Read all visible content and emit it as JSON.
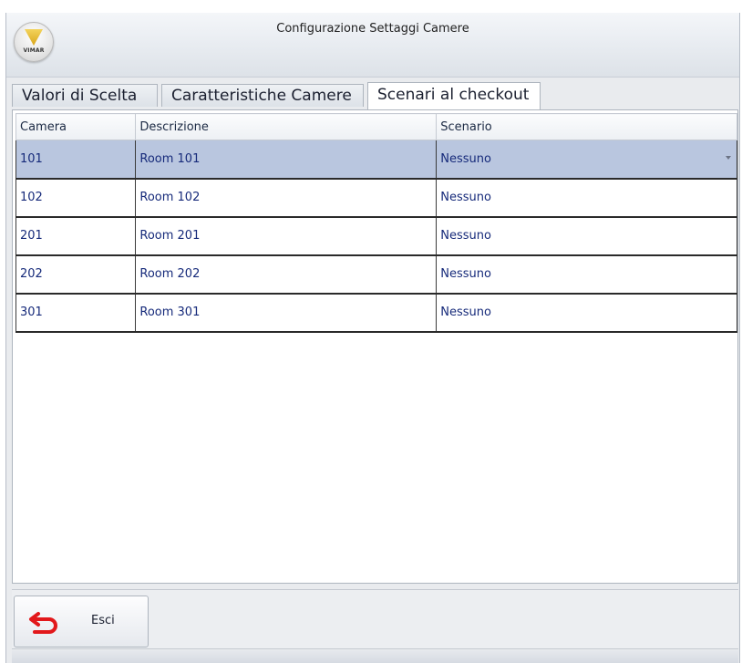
{
  "window": {
    "title": "Configurazione Settaggi Camere",
    "logo_text": "VIMAR"
  },
  "tabs": [
    {
      "label": "Valori di Scelta",
      "active": false
    },
    {
      "label": "Caratteristiche Camere",
      "active": false
    },
    {
      "label": "Scenari al checkout",
      "active": true
    }
  ],
  "table": {
    "columns": [
      "Camera",
      "Descrizione",
      "Scenario"
    ],
    "rows": [
      {
        "camera": "101",
        "descrizione": "Room 101",
        "scenario": "Nessuno",
        "selected": true
      },
      {
        "camera": "102",
        "descrizione": "Room 102",
        "scenario": "Nessuno",
        "selected": false
      },
      {
        "camera": "201",
        "descrizione": "Room 201",
        "scenario": "Nessuno",
        "selected": false
      },
      {
        "camera": "202",
        "descrizione": "Room 202",
        "scenario": "Nessuno",
        "selected": false
      },
      {
        "camera": "301",
        "descrizione": "Room 301",
        "scenario": "Nessuno",
        "selected": false
      }
    ]
  },
  "buttons": {
    "exit_label": "Esci",
    "exit_icon": "return-arrow-icon"
  },
  "colors": {
    "selected_row": "#b9c6df",
    "cell_text": "#162a7a",
    "exit_icon": "#e2181b"
  }
}
